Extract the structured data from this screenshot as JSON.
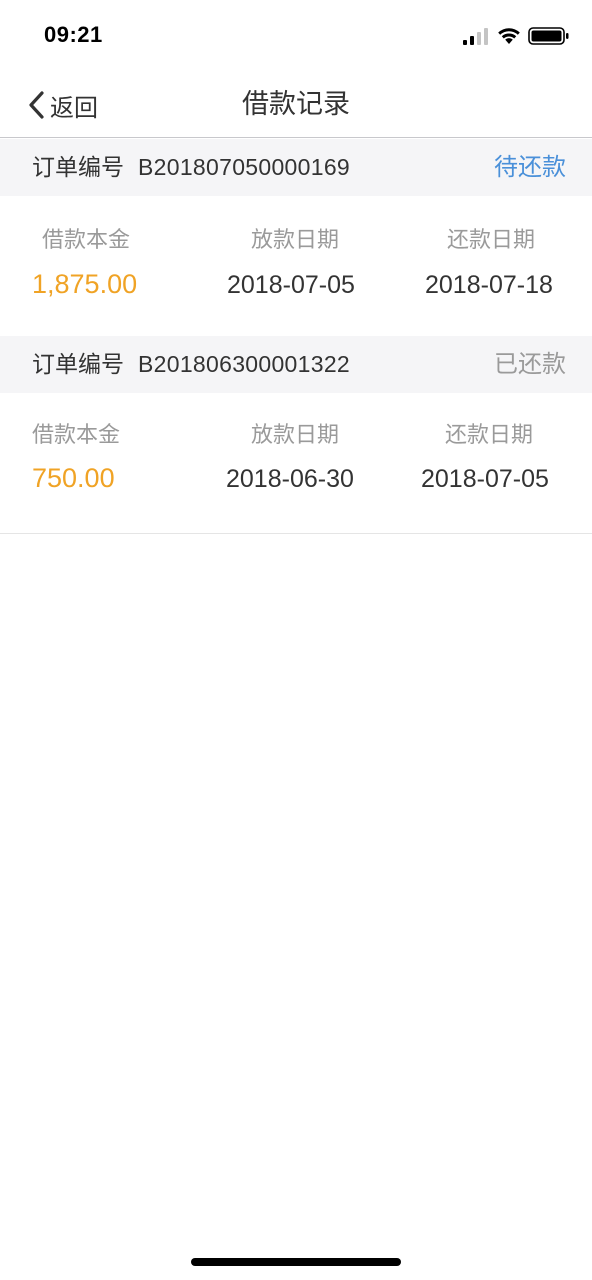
{
  "status_bar": {
    "time": "09:21"
  },
  "nav": {
    "back_label": "返回",
    "title": "借款记录"
  },
  "labels": {
    "order": "订单编号",
    "principal": "借款本金",
    "disburse_date": "放款日期",
    "repay_date": "还款日期"
  },
  "records": [
    {
      "order_number": "B201807050000169",
      "status": "待还款",
      "status_color": "#4a90d9",
      "principal": "1,875.00",
      "disburse_date": "2018-07-05",
      "repay_date": "2018-07-18"
    },
    {
      "order_number": "B201806300001322",
      "status": "已还款",
      "status_color": "#9a9a9a",
      "principal": "750.00",
      "disburse_date": "2018-06-30",
      "repay_date": "2018-07-05"
    }
  ],
  "colors": {
    "amount": "#f0a325",
    "header_bg": "#f5f5f7"
  }
}
